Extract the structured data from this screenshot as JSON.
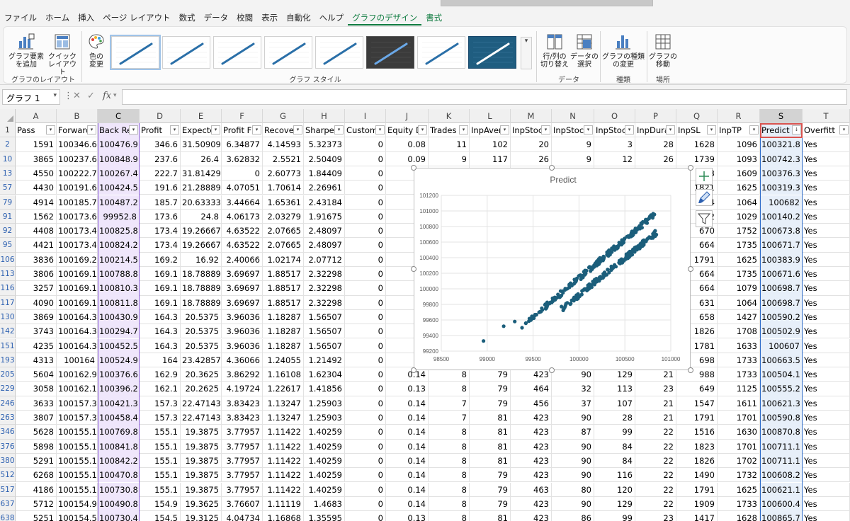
{
  "ribbon": {
    "tabs": [
      {
        "label": "ファイル",
        "state": "normal"
      },
      {
        "label": "ホーム",
        "state": "normal"
      },
      {
        "label": "挿入",
        "state": "normal"
      },
      {
        "label": "ページ レイアウト",
        "state": "normal"
      },
      {
        "label": "数式",
        "state": "normal"
      },
      {
        "label": "データ",
        "state": "normal"
      },
      {
        "label": "校閲",
        "state": "normal"
      },
      {
        "label": "表示",
        "state": "normal"
      },
      {
        "label": "自動化",
        "state": "normal"
      },
      {
        "label": "ヘルプ",
        "state": "normal"
      },
      {
        "label": "グラフのデザイン",
        "state": "active"
      },
      {
        "label": "書式",
        "state": "context"
      }
    ],
    "add_element_line1": "グラフ要素",
    "add_element_line2": "を追加",
    "quick_layout_line1": "クイック",
    "quick_layout_line2": "レイアウト",
    "layout_group": "グラフのレイアウト",
    "change_colors_line1": "色の",
    "change_colors_line2": "変更",
    "styles_group": "グラフ スタイル",
    "switch_row_col_line1": "行/列の",
    "switch_row_col_line2": "切り替え",
    "select_data_line1": "データの",
    "select_data_line2": "選択",
    "data_group": "データ",
    "change_type_line1": "グラフの種類",
    "change_type_line2": "の変更",
    "type_group": "種類",
    "move_chart_line1": "グラフの",
    "move_chart_line2": "移動",
    "location_group": "場所"
  },
  "formula_bar": {
    "name_box": "グラフ 1",
    "fx": "fx",
    "cancel": "✕",
    "enter": "✓"
  },
  "columns": [
    "A",
    "B",
    "C",
    "D",
    "E",
    "F",
    "G",
    "H",
    "I",
    "J",
    "K",
    "L",
    "M",
    "N",
    "O",
    "P",
    "Q",
    "R",
    "S",
    "T"
  ],
  "headers": [
    "Pass",
    "Forward",
    "Back Re",
    "Profit",
    "Expecte",
    "Profit F",
    "Recover",
    "Sharpe",
    "Custom",
    "Equity D",
    "Trades",
    "InpAver",
    "InpStoc",
    "InpStoc",
    "InpStoc",
    "InpDura",
    "InpSL",
    "InpTP",
    "Predict",
    "Overfitt"
  ],
  "header_row_number": "1",
  "rows": [
    {
      "n": "2",
      "v": [
        "1591",
        "100346.6",
        "100476.9",
        "346.6",
        "31.50909",
        "6.34877",
        "4.14593",
        "5.32373",
        "0",
        "0.08",
        "11",
        "102",
        "20",
        "9",
        "3",
        "28",
        "1628",
        "1096",
        "100321.8",
        "Yes"
      ]
    },
    {
      "n": "10",
      "v": [
        "3865",
        "100237.6",
        "100848.9",
        "237.6",
        "26.4",
        "3.62832",
        "2.5521",
        "2.50409",
        "0",
        "0.09",
        "9",
        "117",
        "26",
        "9",
        "12",
        "26",
        "1739",
        "1093",
        "100742.3",
        "Yes"
      ]
    },
    {
      "n": "13",
      "v": [
        "4550",
        "100222.7",
        "100267.4",
        "222.7",
        "31.81429",
        "0",
        "2.60773",
        "1.84409",
        "0",
        "",
        "",
        "",
        "",
        "",
        "",
        "",
        "3",
        "1609",
        "100376.3",
        "Yes"
      ]
    },
    {
      "n": "57",
      "v": [
        "4430",
        "100191.6",
        "100424.5",
        "191.6",
        "21.28889",
        "4.07051",
        "1.70614",
        "2.26961",
        "0",
        "",
        "",
        "",
        "",
        "",
        "",
        "",
        "1821",
        "1625",
        "100319.3",
        "Yes"
      ]
    },
    {
      "n": "79",
      "v": [
        "4914",
        "100185.7",
        "100487.2",
        "185.7",
        "20.63333",
        "3.44664",
        "1.65361",
        "2.43184",
        "0",
        "",
        "",
        "",
        "",
        "",
        "",
        "",
        "14",
        "1064",
        "100682",
        "Yes"
      ]
    },
    {
      "n": "91",
      "v": [
        "1562",
        "100173.6",
        "99952.8",
        "173.6",
        "24.8",
        "4.06173",
        "2.03279",
        "1.91675",
        "0",
        "",
        "",
        "",
        "",
        "",
        "",
        "",
        "2",
        "1029",
        "100140.2",
        "Yes"
      ]
    },
    {
      "n": "92",
      "v": [
        "4408",
        "100173.4",
        "100825.8",
        "173.4",
        "19.26667",
        "4.63522",
        "2.07665",
        "2.48097",
        "0",
        "",
        "",
        "",
        "",
        "",
        "",
        "",
        "670",
        "1752",
        "100673.8",
        "Yes"
      ]
    },
    {
      "n": "95",
      "v": [
        "4421",
        "100173.4",
        "100824.2",
        "173.4",
        "19.26667",
        "4.63522",
        "2.07665",
        "2.48097",
        "0",
        "",
        "",
        "",
        "",
        "",
        "",
        "",
        "664",
        "1735",
        "100671.7",
        "Yes"
      ]
    },
    {
      "n": "106",
      "v": [
        "3836",
        "100169.2",
        "100214.5",
        "169.2",
        "16.92",
        "2.40066",
        "1.02174",
        "2.07712",
        "0",
        "",
        "",
        "",
        "",
        "",
        "",
        "",
        "1791",
        "1625",
        "100383.9",
        "Yes"
      ]
    },
    {
      "n": "113",
      "v": [
        "3806",
        "100169.1",
        "100788.8",
        "169.1",
        "18.78889",
        "3.69697",
        "1.88517",
        "2.32298",
        "0",
        "",
        "",
        "",
        "",
        "",
        "",
        "",
        "664",
        "1735",
        "100671.6",
        "Yes"
      ]
    },
    {
      "n": "116",
      "v": [
        "3257",
        "100169.1",
        "100810.3",
        "169.1",
        "18.78889",
        "3.69697",
        "1.88517",
        "2.32298",
        "0",
        "",
        "",
        "",
        "",
        "",
        "",
        "",
        "664",
        "1079",
        "100698.7",
        "Yes"
      ]
    },
    {
      "n": "117",
      "v": [
        "4090",
        "100169.1",
        "100811.8",
        "169.1",
        "18.78889",
        "3.69697",
        "1.88517",
        "2.32298",
        "0",
        "",
        "",
        "",
        "",
        "",
        "",
        "",
        "631",
        "1064",
        "100698.7",
        "Yes"
      ]
    },
    {
      "n": "130",
      "v": [
        "3869",
        "100164.3",
        "100430.9",
        "164.3",
        "20.5375",
        "3.96036",
        "1.18287",
        "1.56507",
        "0",
        "",
        "",
        "",
        "",
        "",
        "",
        "",
        "658",
        "1427",
        "100590.2",
        "Yes"
      ]
    },
    {
      "n": "142",
      "v": [
        "3743",
        "100164.3",
        "100294.7",
        "164.3",
        "20.5375",
        "3.96036",
        "1.18287",
        "1.56507",
        "0",
        "",
        "",
        "",
        "",
        "",
        "",
        "",
        "1826",
        "1708",
        "100502.9",
        "Yes"
      ]
    },
    {
      "n": "151",
      "v": [
        "4235",
        "100164.3",
        "100452.5",
        "164.3",
        "20.5375",
        "3.96036",
        "1.18287",
        "1.56507",
        "0",
        "",
        "",
        "",
        "",
        "",
        "",
        "",
        "1781",
        "1633",
        "100607",
        "Yes"
      ]
    },
    {
      "n": "193",
      "v": [
        "4313",
        "100164",
        "100524.9",
        "164",
        "23.42857",
        "4.36066",
        "1.24055",
        "1.21492",
        "0",
        "",
        "",
        "",
        "",
        "",
        "",
        "",
        "698",
        "1733",
        "100663.5",
        "Yes"
      ]
    },
    {
      "n": "205",
      "v": [
        "5604",
        "100162.9",
        "100376.6",
        "162.9",
        "20.3625",
        "3.86292",
        "1.16108",
        "1.62304",
        "0",
        "0.14",
        "8",
        "79",
        "423",
        "90",
        "129",
        "21",
        "988",
        "1733",
        "100504.1",
        "Yes"
      ]
    },
    {
      "n": "229",
      "v": [
        "3058",
        "100162.1",
        "100396.2",
        "162.1",
        "20.2625",
        "4.19724",
        "1.22617",
        "1.41856",
        "0",
        "0.13",
        "8",
        "79",
        "464",
        "32",
        "113",
        "23",
        "649",
        "1125",
        "100555.2",
        "Yes"
      ]
    },
    {
      "n": "246",
      "v": [
        "3633",
        "100157.3",
        "100421.3",
        "157.3",
        "22.47143",
        "3.83423",
        "1.13247",
        "1.25903",
        "0",
        "0.14",
        "7",
        "79",
        "456",
        "37",
        "107",
        "21",
        "1547",
        "1611",
        "100621.3",
        "Yes"
      ]
    },
    {
      "n": "263",
      "v": [
        "3807",
        "100157.3",
        "100458.4",
        "157.3",
        "22.47143",
        "3.83423",
        "1.13247",
        "1.25903",
        "0",
        "0.14",
        "7",
        "81",
        "423",
        "90",
        "28",
        "21",
        "1791",
        "1701",
        "100590.8",
        "Yes"
      ]
    },
    {
      "n": "346",
      "v": [
        "5628",
        "100155.1",
        "100769.8",
        "155.1",
        "19.3875",
        "3.77957",
        "1.11422",
        "1.40259",
        "0",
        "0.14",
        "8",
        "81",
        "423",
        "87",
        "99",
        "22",
        "1516",
        "1630",
        "100870.8",
        "Yes"
      ]
    },
    {
      "n": "376",
      "v": [
        "5898",
        "100155.1",
        "100841.8",
        "155.1",
        "19.3875",
        "3.77957",
        "1.11422",
        "1.40259",
        "0",
        "0.14",
        "8",
        "81",
        "423",
        "90",
        "84",
        "22",
        "1823",
        "1701",
        "100711.1",
        "Yes"
      ]
    },
    {
      "n": "380",
      "v": [
        "5291",
        "100155.1",
        "100842.2",
        "155.1",
        "19.3875",
        "3.77957",
        "1.11422",
        "1.40259",
        "0",
        "0.14",
        "8",
        "81",
        "423",
        "90",
        "84",
        "22",
        "1826",
        "1702",
        "100711.1",
        "Yes"
      ]
    },
    {
      "n": "512",
      "v": [
        "6268",
        "100155.1",
        "100470.8",
        "155.1",
        "19.3875",
        "3.77957",
        "1.11422",
        "1.40259",
        "0",
        "0.14",
        "8",
        "79",
        "423",
        "90",
        "116",
        "22",
        "1490",
        "1732",
        "100608.2",
        "Yes"
      ]
    },
    {
      "n": "517",
      "v": [
        "4186",
        "100155.1",
        "100730.8",
        "155.1",
        "19.3875",
        "3.77957",
        "1.11422",
        "1.40259",
        "0",
        "0.14",
        "8",
        "79",
        "463",
        "80",
        "120",
        "22",
        "1791",
        "1625",
        "100621.1",
        "Yes"
      ]
    },
    {
      "n": "637",
      "v": [
        "5712",
        "100154.9",
        "100490.8",
        "154.9",
        "19.3625",
        "3.76607",
        "1.11119",
        "1.4683",
        "0",
        "0.14",
        "8",
        "79",
        "423",
        "90",
        "129",
        "22",
        "1909",
        "1733",
        "100600.4",
        "Yes"
      ]
    },
    {
      "n": "638",
      "v": [
        "5251",
        "100154.5",
        "100730.4",
        "154.5",
        "19.3125",
        "4.04734",
        "1.16868",
        "1.35595",
        "0",
        "0.13",
        "8",
        "81",
        "423",
        "86",
        "99",
        "23",
        "1417",
        "1628",
        "100865.7",
        "Yes"
      ]
    }
  ],
  "chart_data": {
    "type": "scatter",
    "title": "Predict",
    "xlabel": "",
    "ylabel": "",
    "xlim": [
      98500,
      101000
    ],
    "ylim": [
      99200,
      101200
    ],
    "xticks": [
      98500,
      99000,
      99500,
      100000,
      100500,
      101000
    ],
    "yticks": [
      99200,
      99400,
      99600,
      99800,
      100000,
      100200,
      100400,
      100600,
      100800,
      101000,
      101200
    ],
    "grid": true,
    "legend": "none",
    "color": "#1b5e7b",
    "series": [
      {
        "name": "",
        "bands": [
          {
            "x": [
              99420,
              100850
            ],
            "y": [
              99560,
              100980
            ]
          },
          {
            "x": [
              99800,
              100850
            ],
            "y": [
              99730,
              100730
            ]
          }
        ],
        "outliers": [
          [
            98960,
            99330
          ],
          [
            99180,
            99520
          ],
          [
            99300,
            99580
          ],
          [
            99380,
            99500
          ]
        ]
      }
    ]
  }
}
